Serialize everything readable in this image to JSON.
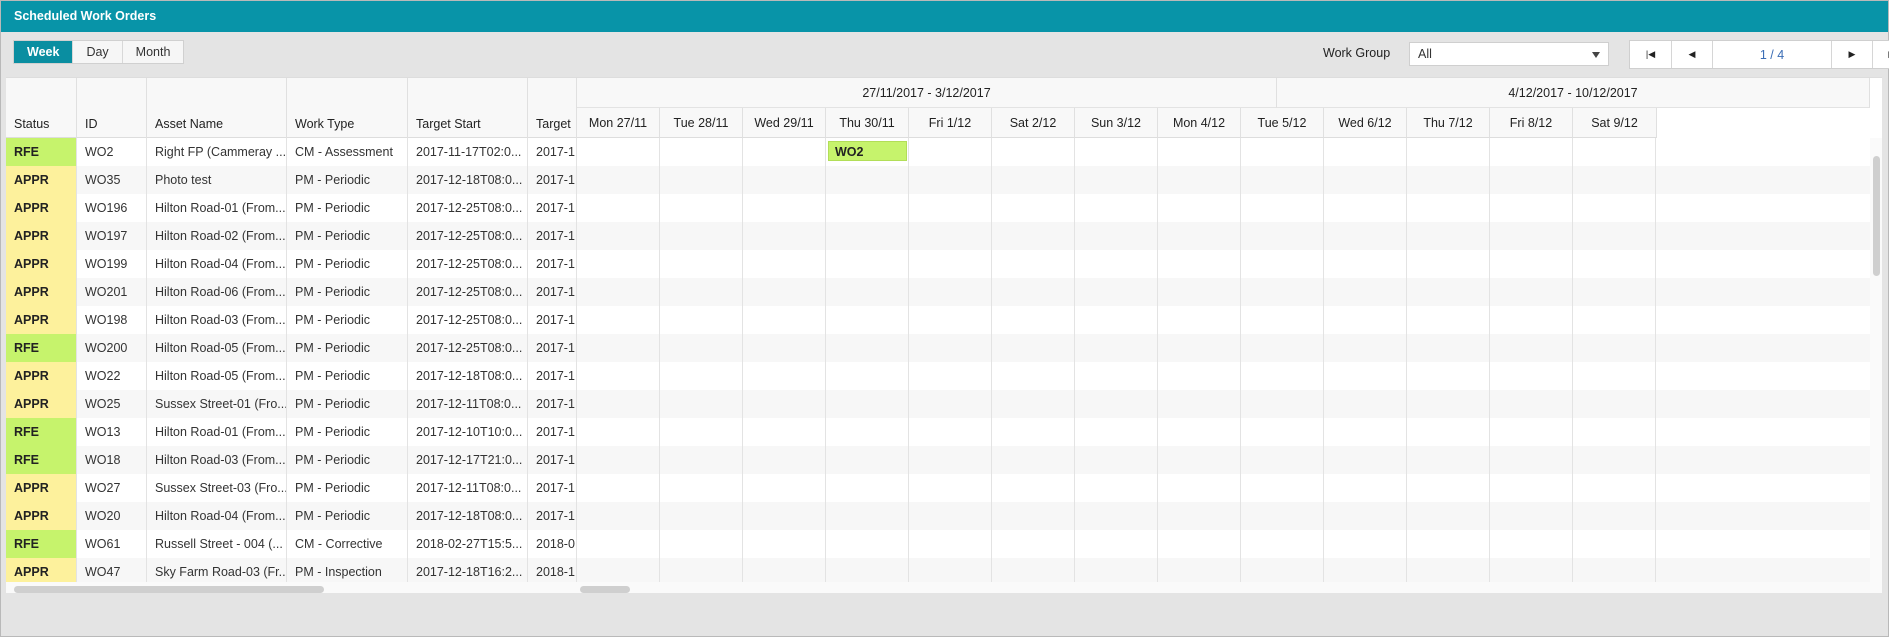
{
  "window": {
    "title": "Scheduled Work Orders"
  },
  "toolbar": {
    "views": [
      {
        "label": "Week",
        "active": true
      },
      {
        "label": "Day",
        "active": false
      },
      {
        "label": "Month",
        "active": false
      }
    ],
    "work_group_label": "Work Group",
    "work_group_value": "All",
    "pager": {
      "indicator": "1 / 4"
    }
  },
  "colors": {
    "accent": "#0894a8",
    "rfe": "#c6f36c",
    "appr": "#fdf19c"
  },
  "table": {
    "columns": [
      "Status",
      "ID",
      "Asset Name",
      "Work Type",
      "Target Start",
      "Target"
    ],
    "rows": [
      {
        "status": "RFE",
        "id": "WO2",
        "asset": "Right FP (Cammeray ...",
        "type": "CM - Assessment",
        "start": "2017-11-17T02:0...",
        "target": "2017-1"
      },
      {
        "status": "APPR",
        "id": "WO35",
        "asset": "Photo test",
        "type": "PM - Periodic",
        "start": "2017-12-18T08:0...",
        "target": "2017-1"
      },
      {
        "status": "APPR",
        "id": "WO196",
        "asset": "Hilton Road-01 (From...",
        "type": "PM - Periodic",
        "start": "2017-12-25T08:0...",
        "target": "2017-1"
      },
      {
        "status": "APPR",
        "id": "WO197",
        "asset": "Hilton Road-02 (From...",
        "type": "PM - Periodic",
        "start": "2017-12-25T08:0...",
        "target": "2017-1"
      },
      {
        "status": "APPR",
        "id": "WO199",
        "asset": "Hilton Road-04 (From...",
        "type": "PM - Periodic",
        "start": "2017-12-25T08:0...",
        "target": "2017-1"
      },
      {
        "status": "APPR",
        "id": "WO201",
        "asset": "Hilton Road-06 (From...",
        "type": "PM - Periodic",
        "start": "2017-12-25T08:0...",
        "target": "2017-1"
      },
      {
        "status": "APPR",
        "id": "WO198",
        "asset": "Hilton Road-03 (From...",
        "type": "PM - Periodic",
        "start": "2017-12-25T08:0...",
        "target": "2017-1"
      },
      {
        "status": "RFE",
        "id": "WO200",
        "asset": "Hilton Road-05 (From...",
        "type": "PM - Periodic",
        "start": "2017-12-25T08:0...",
        "target": "2017-1"
      },
      {
        "status": "APPR",
        "id": "WO22",
        "asset": "Hilton Road-05 (From...",
        "type": "PM - Periodic",
        "start": "2017-12-18T08:0...",
        "target": "2017-1"
      },
      {
        "status": "APPR",
        "id": "WO25",
        "asset": "Sussex Street-01 (Fro...",
        "type": "PM - Periodic",
        "start": "2017-12-11T08:0...",
        "target": "2017-1"
      },
      {
        "status": "RFE",
        "id": "WO13",
        "asset": "Hilton Road-01 (From...",
        "type": "PM - Periodic",
        "start": "2017-12-10T10:0...",
        "target": "2017-1"
      },
      {
        "status": "RFE",
        "id": "WO18",
        "asset": "Hilton Road-03 (From...",
        "type": "PM - Periodic",
        "start": "2017-12-17T21:0...",
        "target": "2017-1"
      },
      {
        "status": "APPR",
        "id": "WO27",
        "asset": "Sussex Street-03 (Fro...",
        "type": "PM - Periodic",
        "start": "2017-12-11T08:0...",
        "target": "2017-1"
      },
      {
        "status": "APPR",
        "id": "WO20",
        "asset": "Hilton Road-04 (From...",
        "type": "PM - Periodic",
        "start": "2017-12-18T08:0...",
        "target": "2017-1"
      },
      {
        "status": "RFE",
        "id": "WO61",
        "asset": "Russell Street - 004 (...",
        "type": "CM - Corrective",
        "start": "2018-02-27T15:5...",
        "target": "2018-0"
      },
      {
        "status": "APPR",
        "id": "WO47",
        "asset": "Sky Farm Road-03 (Fr...",
        "type": "PM - Inspection",
        "start": "2017-12-18T16:2...",
        "target": "2018-1"
      }
    ]
  },
  "schedule": {
    "weeks": [
      "27/11/2017 - 3/12/2017",
      "4/12/2017 - 10/12/2017"
    ],
    "days": [
      "Mon 27/11",
      "Tue 28/11",
      "Wed 29/11",
      "Thu 30/11",
      "Fri 1/12",
      "Sat 2/12",
      "Sun 3/12",
      "Mon 4/12",
      "Tue 5/12",
      "Wed 6/12",
      "Thu 7/12",
      "Fri 8/12",
      "Sat 9/12"
    ],
    "events": [
      {
        "label": "WO2",
        "row": 0,
        "day": 3
      }
    ]
  }
}
